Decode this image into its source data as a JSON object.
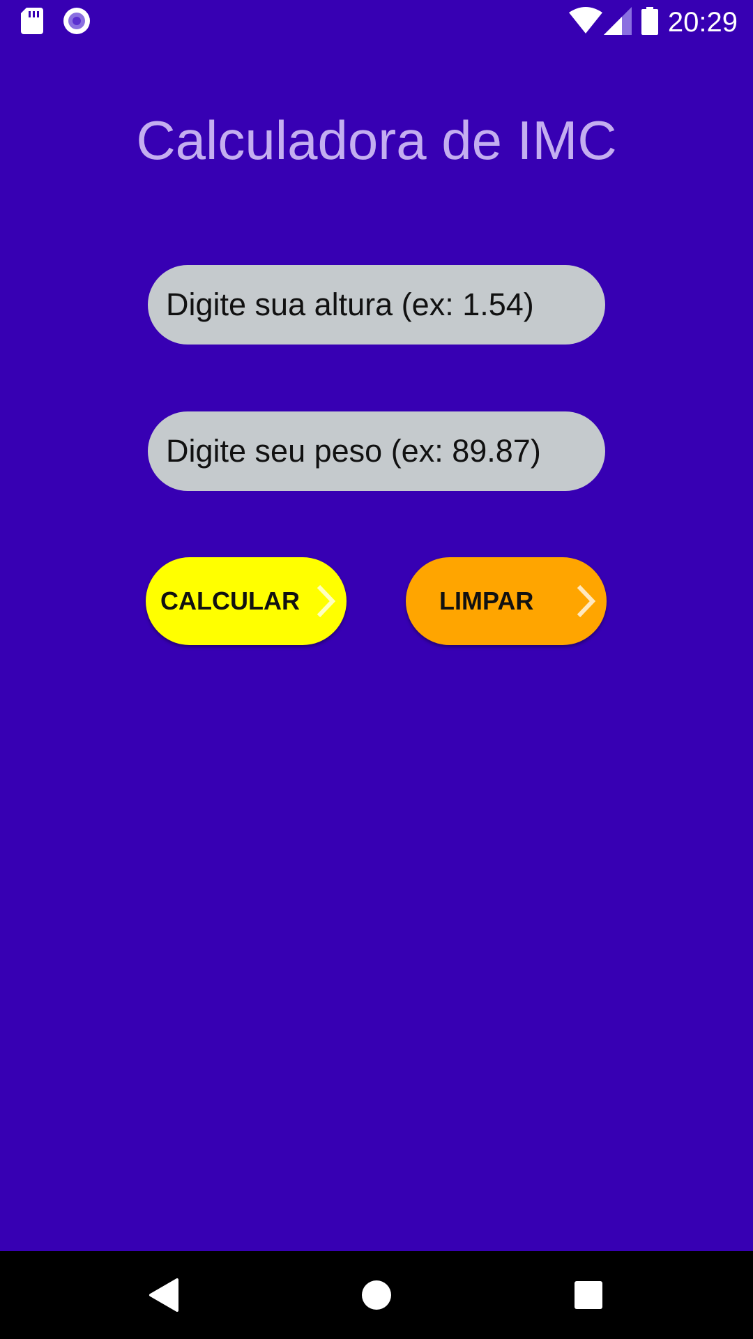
{
  "status_bar": {
    "time": "20:29",
    "icons": [
      "sd-card-icon",
      "record-icon",
      "wifi-icon",
      "signal-icon",
      "battery-icon"
    ]
  },
  "title": "Calculadora de IMC",
  "inputs": {
    "height": {
      "value": "",
      "placeholder": "Digite sua altura (ex: 1.54)"
    },
    "weight": {
      "value": "",
      "placeholder": "Digite seu peso (ex: 89.87)"
    }
  },
  "buttons": {
    "calculate": {
      "label": "CALCULAR",
      "icon": "chevron-right-icon",
      "color": "#ffff00"
    },
    "clear": {
      "label": "LIMPAR",
      "icon": "chevron-right-icon",
      "color": "#ffa500"
    }
  },
  "nav_bar": {
    "icons": [
      "back-icon",
      "home-icon",
      "recents-icon"
    ]
  },
  "colors": {
    "background": "#3700b3",
    "title": "#c4aef0",
    "input_background": "#c5cacd",
    "nav_background": "#000000"
  }
}
